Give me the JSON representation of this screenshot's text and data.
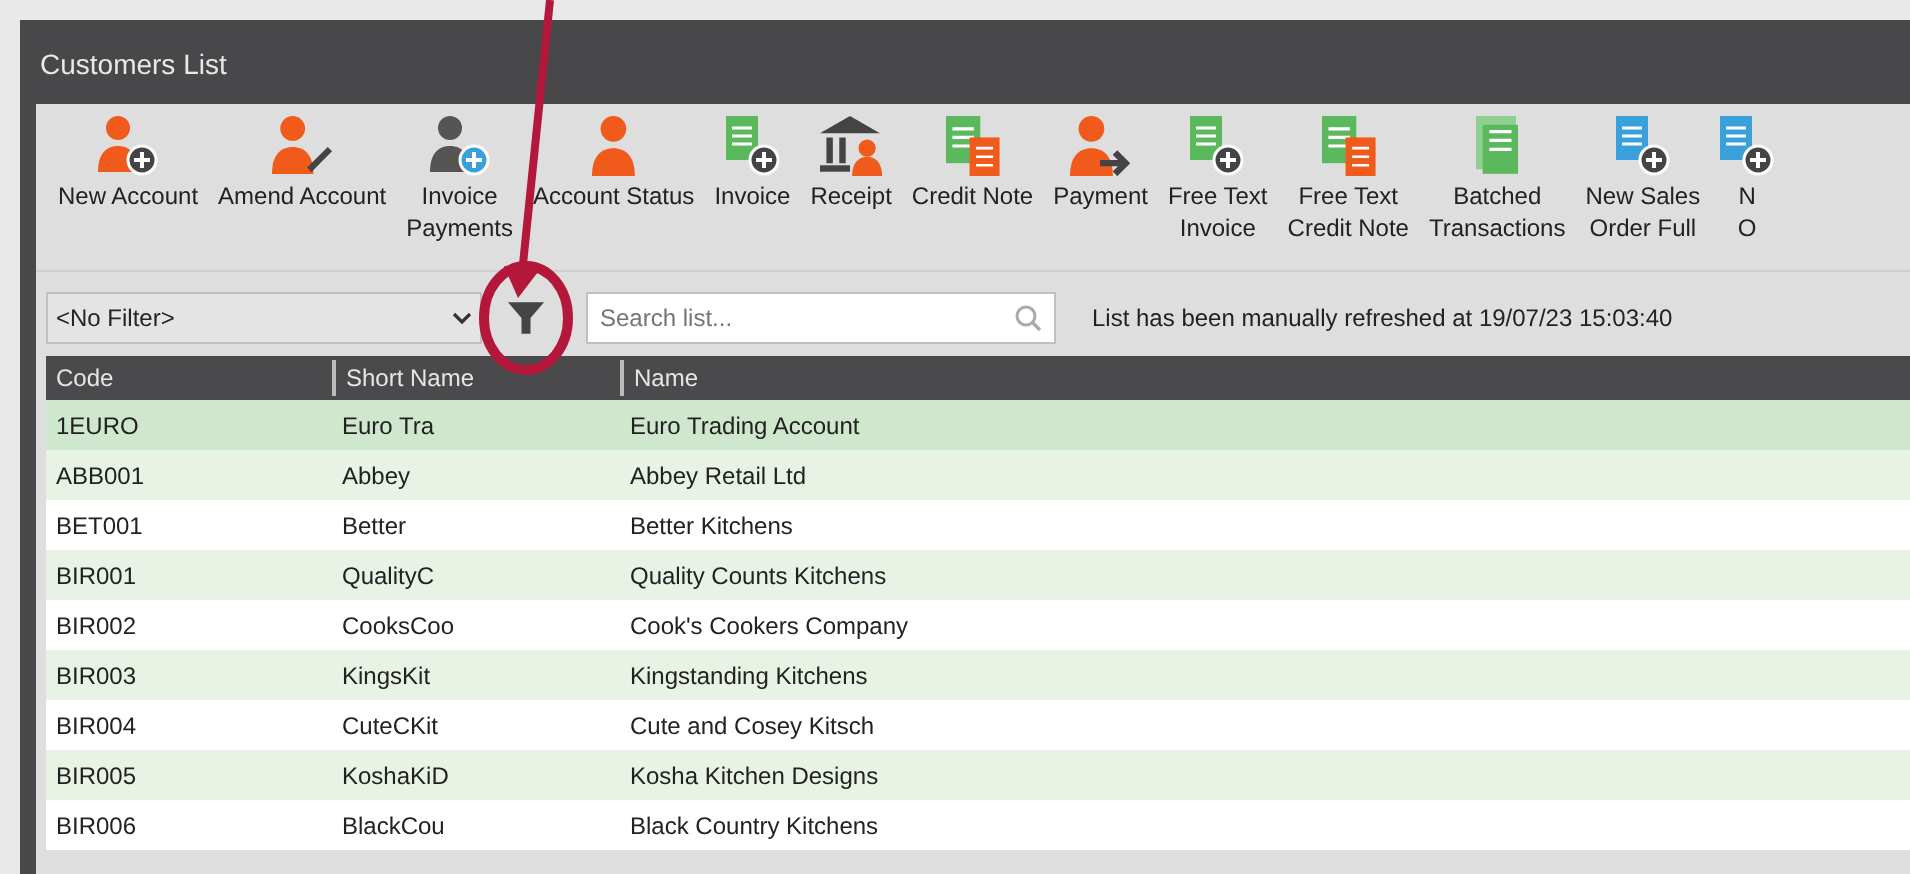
{
  "window": {
    "title": "Customers List"
  },
  "toolbar": [
    {
      "kind": "person-add",
      "lines": [
        "New Account"
      ]
    },
    {
      "kind": "person-edit",
      "lines": [
        "Amend Account"
      ]
    },
    {
      "kind": "person-add-blue",
      "lines": [
        "Invoice",
        "Payments"
      ]
    },
    {
      "kind": "person",
      "lines": [
        "Account Status"
      ]
    },
    {
      "kind": "doc-add",
      "lines": [
        "Invoice"
      ]
    },
    {
      "kind": "bank",
      "lines": [
        "Receipt"
      ]
    },
    {
      "kind": "doc-orange",
      "lines": [
        "Credit Note"
      ]
    },
    {
      "kind": "person-arrow",
      "lines": [
        "Payment"
      ]
    },
    {
      "kind": "doc-add",
      "lines": [
        "Free Text",
        "Invoice"
      ]
    },
    {
      "kind": "doc-orange",
      "lines": [
        "Free Text",
        "Credit Note"
      ]
    },
    {
      "kind": "doc-stack",
      "lines": [
        "Batched",
        "Transactions"
      ]
    },
    {
      "kind": "doc-add-blue",
      "lines": [
        "New Sales",
        "Order Full"
      ]
    },
    {
      "kind": "doc-add-blue",
      "lines": [
        "N",
        "O"
      ]
    }
  ],
  "filter": {
    "value": "<No Filter>"
  },
  "search": {
    "placeholder": "Search list..."
  },
  "refresh_note": "List has been manually refreshed at 19/07/23 15:03:40",
  "table": {
    "columns": [
      "Code",
      "Short Name",
      "Name"
    ],
    "rows": [
      {
        "code": "1EURO",
        "short_name": "Euro Tra",
        "name": "Euro Trading Account",
        "selected": true
      },
      {
        "code": "ABB001",
        "short_name": "Abbey",
        "name": "Abbey Retail Ltd",
        "selected": false
      },
      {
        "code": "BET001",
        "short_name": "Better",
        "name": "Better Kitchens",
        "selected": false
      },
      {
        "code": "BIR001",
        "short_name": "QualityC",
        "name": "Quality Counts Kitchens",
        "selected": false
      },
      {
        "code": "BIR002",
        "short_name": "CooksCoo",
        "name": "Cook's Cookers Company",
        "selected": false
      },
      {
        "code": "BIR003",
        "short_name": "KingsKit",
        "name": "Kingstanding Kitchens",
        "selected": false
      },
      {
        "code": "BIR004",
        "short_name": "CuteCKit",
        "name": "Cute and Cosey Kitsch",
        "selected": false
      },
      {
        "code": "BIR005",
        "short_name": "KoshaKiD",
        "name": "Kosha Kitchen Designs",
        "selected": false
      },
      {
        "code": "BIR006",
        "short_name": "BlackCou",
        "name": "Black Country Kitchens",
        "selected": false
      }
    ]
  }
}
